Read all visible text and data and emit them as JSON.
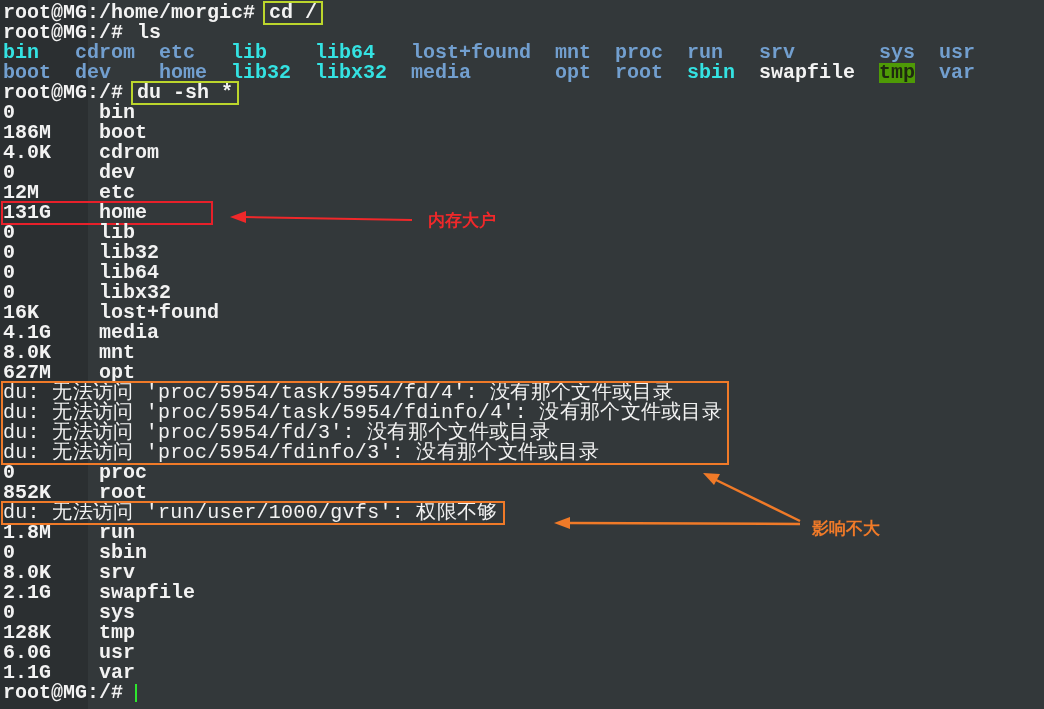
{
  "session": [
    {
      "kind": "prompt",
      "prompt": "root@MG:/home/morgic#",
      "command": "cd /",
      "boxed": true
    },
    {
      "kind": "prompt",
      "prompt": "root@MG:/#",
      "command": "ls",
      "boxed": false
    },
    {
      "kind": "listing",
      "rows": [
        [
          {
            "name": "bin",
            "kind": "link"
          },
          {
            "name": "cdrom",
            "kind": "dir"
          },
          {
            "name": "etc",
            "kind": "dir"
          },
          {
            "name": "lib",
            "kind": "link"
          },
          {
            "name": "lib64",
            "kind": "link"
          },
          {
            "name": "lost+found",
            "kind": "dir"
          },
          {
            "name": "mnt",
            "kind": "dir"
          },
          {
            "name": "proc",
            "kind": "dir"
          },
          {
            "name": "run",
            "kind": "dir"
          },
          {
            "name": "srv",
            "kind": "dir"
          },
          {
            "name": "sys",
            "kind": "dir"
          },
          {
            "name": "usr",
            "kind": "dir"
          }
        ],
        [
          {
            "name": "boot",
            "kind": "dir"
          },
          {
            "name": "dev",
            "kind": "dir"
          },
          {
            "name": "home",
            "kind": "dir"
          },
          {
            "name": "lib32",
            "kind": "link"
          },
          {
            "name": "libx32",
            "kind": "link"
          },
          {
            "name": "media",
            "kind": "dir"
          },
          {
            "name": "opt",
            "kind": "dir"
          },
          {
            "name": "root",
            "kind": "dir"
          },
          {
            "name": "sbin",
            "kind": "link"
          },
          {
            "name": "swapfile",
            "kind": "file"
          },
          {
            "name": "tmp",
            "kind": "sticky"
          },
          {
            "name": "var",
            "kind": "dir"
          }
        ]
      ]
    },
    {
      "kind": "prompt",
      "prompt": "root@MG:/#",
      "command": "du -sh *",
      "boxed": true
    },
    {
      "kind": "usage",
      "size": "0",
      "name": "bin"
    },
    {
      "kind": "usage",
      "size": "186M",
      "name": "boot"
    },
    {
      "kind": "usage",
      "size": "4.0K",
      "name": "cdrom"
    },
    {
      "kind": "usage",
      "size": "0",
      "name": "dev"
    },
    {
      "kind": "usage",
      "size": "12M",
      "name": "etc"
    },
    {
      "kind": "usage",
      "size": "131G",
      "name": "home",
      "color": "#e8202a"
    },
    {
      "kind": "usage",
      "size": "0",
      "name": "lib"
    },
    {
      "kind": "usage",
      "size": "0",
      "name": "lib32"
    },
    {
      "kind": "usage",
      "size": "0",
      "name": "lib64"
    },
    {
      "kind": "usage",
      "size": "0",
      "name": "libx32"
    },
    {
      "kind": "usage",
      "size": "16K",
      "name": "lost+found"
    },
    {
      "kind": "usage",
      "size": "4.1G",
      "name": "media"
    },
    {
      "kind": "usage",
      "size": "8.0K",
      "name": "mnt"
    },
    {
      "kind": "usage",
      "size": "627M",
      "name": "opt"
    },
    {
      "kind": "errors",
      "color": "#f07a28",
      "lines": [
        "du: 无法访问 'proc/5954/task/5954/fd/4': 没有那个文件或目录",
        "du: 无法访问 'proc/5954/task/5954/fdinfo/4': 没有那个文件或目录",
        "du: 无法访问 'proc/5954/fd/3': 没有那个文件或目录",
        "du: 无法访问 'proc/5954/fdinfo/3': 没有那个文件或目录"
      ]
    },
    {
      "kind": "usage",
      "size": "0",
      "name": "proc"
    },
    {
      "kind": "usage",
      "size": "852K",
      "name": "root"
    },
    {
      "kind": "errors",
      "color": "#f07a28",
      "lines": [
        "du: 无法访问 'run/user/1000/gvfs': 权限不够"
      ]
    },
    {
      "kind": "usage",
      "size": "1.8M",
      "name": "run"
    },
    {
      "kind": "usage",
      "size": "0",
      "name": "sbin"
    },
    {
      "kind": "usage",
      "size": "8.0K",
      "name": "srv"
    },
    {
      "kind": "usage",
      "size": "2.1G",
      "name": "swapfile"
    },
    {
      "kind": "usage",
      "size": "0",
      "name": "sys"
    },
    {
      "kind": "usage",
      "size": "128K",
      "name": "tmp"
    },
    {
      "kind": "usage",
      "size": "6.0G",
      "name": "usr"
    },
    {
      "kind": "usage",
      "size": "1.1G",
      "name": "var"
    },
    {
      "kind": "prompt",
      "prompt": "root@MG:/#",
      "cursor": true
    }
  ],
  "annotations": [
    {
      "text": "内存大户",
      "color": "#f0282a"
    },
    {
      "text": "影响不大",
      "color": "#f07a28"
    }
  ]
}
